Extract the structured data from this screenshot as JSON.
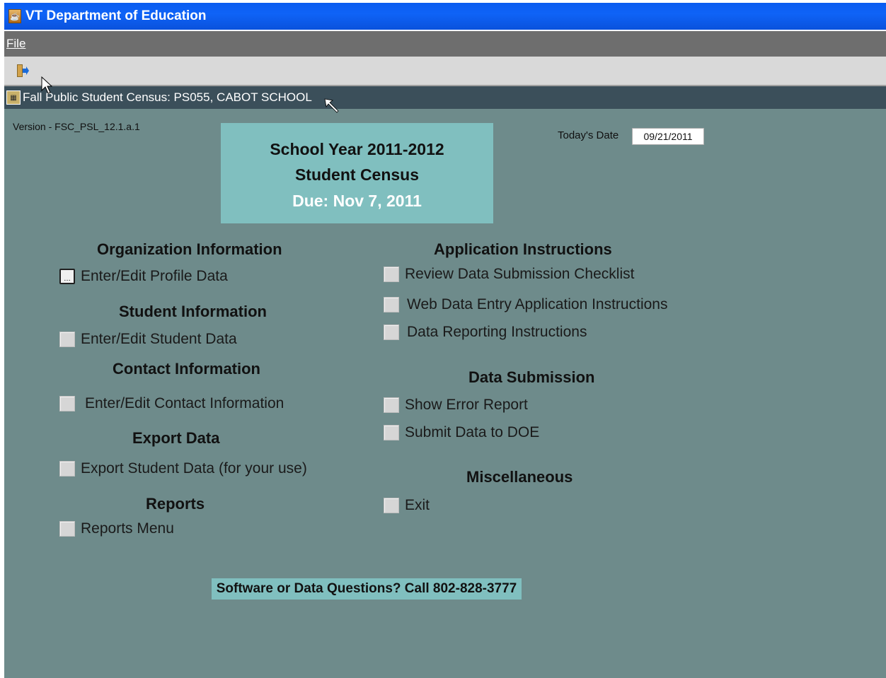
{
  "window": {
    "title": "VT Department of Education"
  },
  "menu": {
    "file": "File"
  },
  "toolbar": {
    "exit_icon": "exit-door-icon"
  },
  "form": {
    "title": "Fall Public Student Census:  PS055, CABOT SCHOOL"
  },
  "version": "Version - FSC_PSL_12.1.a.1",
  "banner": {
    "line1": "School Year 2011-2012",
    "line2": "Student Census",
    "line3": "Due:  Nov 7, 2011"
  },
  "date": {
    "label": "Today's Date",
    "value": "09/21/2011"
  },
  "sections": {
    "organization": {
      "heading": "Organization Information",
      "item": "Enter/Edit Profile Data"
    },
    "student": {
      "heading": "Student Information",
      "item": "Enter/Edit Student Data"
    },
    "contact": {
      "heading": "Contact Information",
      "item": "Enter/Edit Contact Information"
    },
    "export": {
      "heading": "Export Data",
      "item": "Export Student Data (for your use)"
    },
    "reports": {
      "heading": "Reports",
      "item": "Reports Menu"
    },
    "instructions": {
      "heading": "Application Instructions",
      "items": [
        "Review Data Submission Checklist",
        "Web Data Entry Application Instructions",
        "Data Reporting Instructions"
      ]
    },
    "submission": {
      "heading": "Data Submission",
      "items": [
        "Show Error Report",
        "Submit Data to DOE"
      ]
    },
    "misc": {
      "heading": "Miscellaneous",
      "item": "Exit"
    }
  },
  "footer": "Software or Data Questions?  Call 802-828-3777",
  "colors": {
    "title_bar": "#0f63f7",
    "canvas": "#6e8b8b",
    "banner": "#80bfbf",
    "form_bar": "#3b4f5a"
  }
}
